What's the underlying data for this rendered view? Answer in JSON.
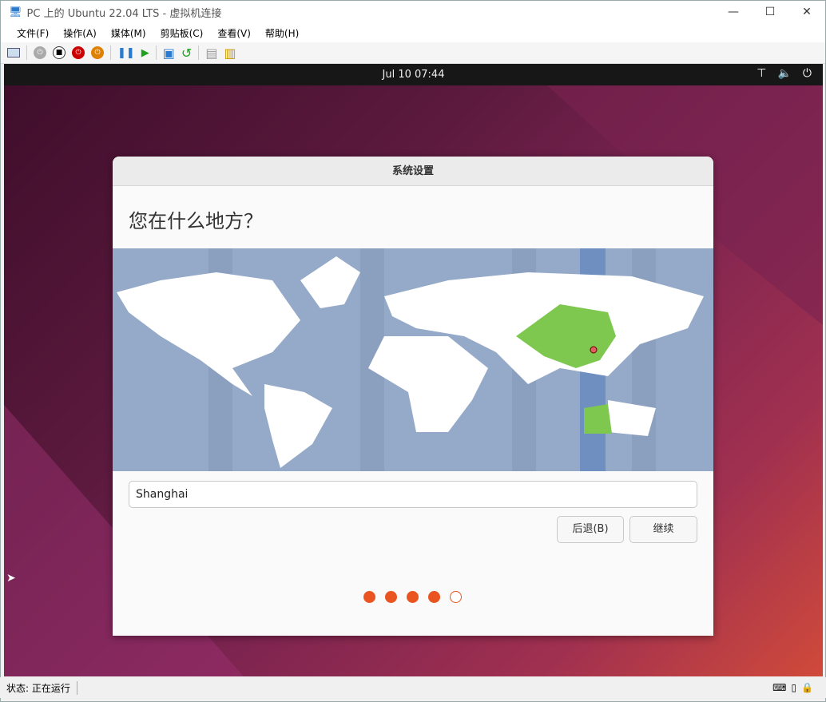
{
  "window": {
    "title": "PC 上的 Ubuntu 22.04 LTS - 虚拟机连接",
    "minimize": "—",
    "maximize": "☐",
    "close": "✕"
  },
  "menu": [
    "文件(F)",
    "操作(A)",
    "媒体(M)",
    "剪贴板(C)",
    "查看(V)",
    "帮助(H)"
  ],
  "topbar": {
    "clock": "Jul 10  07:44"
  },
  "dialog": {
    "title": "系统设置",
    "question": "您在什么地方？",
    "location_value": "Shanghai",
    "back_label": "后退(B)",
    "continue_label": "继续",
    "progress": {
      "completed": 4,
      "total": 5
    }
  },
  "status": {
    "text": "状态: 正在运行"
  },
  "colors": {
    "accent": "#e95420",
    "selected_tz": "#7ec850",
    "map_ocean": "#95a9c8"
  }
}
